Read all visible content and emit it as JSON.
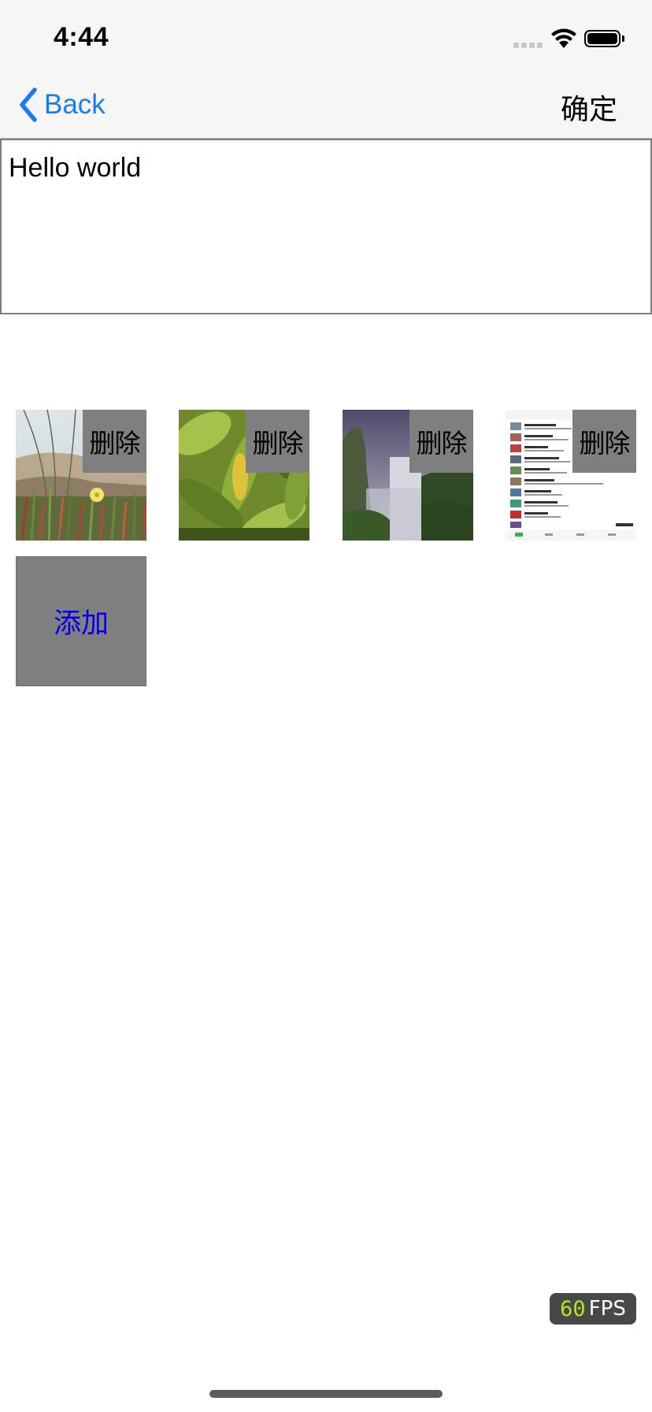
{
  "status_bar": {
    "time": "4:44"
  },
  "nav": {
    "back_label": "Back",
    "confirm_label": "确定",
    "accent_color": "#1a7cf5"
  },
  "text_area": {
    "value": "Hello world"
  },
  "photos": [
    {
      "name": "dune-flower-photo",
      "delete_label": "删除"
    },
    {
      "name": "leaves-photo",
      "delete_label": "删除"
    },
    {
      "name": "waterfall-photo",
      "delete_label": "删除"
    },
    {
      "name": "app-screenshot-photo",
      "delete_label": "删除"
    }
  ],
  "add_button": {
    "label": "添加",
    "text_color": "#0000ee"
  },
  "fps": {
    "value": "60",
    "unit": "FPS"
  }
}
